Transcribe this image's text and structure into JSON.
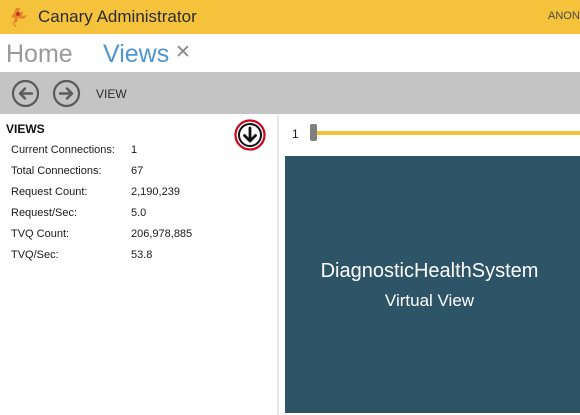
{
  "window": {
    "title": "Canary Administrator",
    "user": "ANON"
  },
  "tabs": {
    "home_label": "Home",
    "views_label": "Views",
    "close_glyph": "✕"
  },
  "toolbar": {
    "back_icon": "arrow-left-circle-icon",
    "forward_icon": "arrow-right-circle-icon",
    "label": "VIEW"
  },
  "panel": {
    "title": "VIEWS",
    "download_icon": "arrow-down-circle-icon",
    "stats": [
      {
        "label": "Current Connections:",
        "value": "1"
      },
      {
        "label": "Total Connections:",
        "value": "67"
      },
      {
        "label": "Request Count:",
        "value": "2,190,239"
      },
      {
        "label": "Request/Sec:",
        "value": "5.0"
      },
      {
        "label": "TVQ Count:",
        "value": "206,978,885"
      },
      {
        "label": "TVQ/Sec:",
        "value": "53.8"
      }
    ]
  },
  "slider": {
    "value": "1"
  },
  "view_card": {
    "name": "DiagnosticHealthSystem",
    "type": "Virtual View"
  },
  "colors": {
    "accent": "#f4c33b",
    "tab_active": "#4f95cf",
    "card_background": "#2e5567",
    "toolbar": "#c4c4c4",
    "download_ring": "#d0021b"
  }
}
